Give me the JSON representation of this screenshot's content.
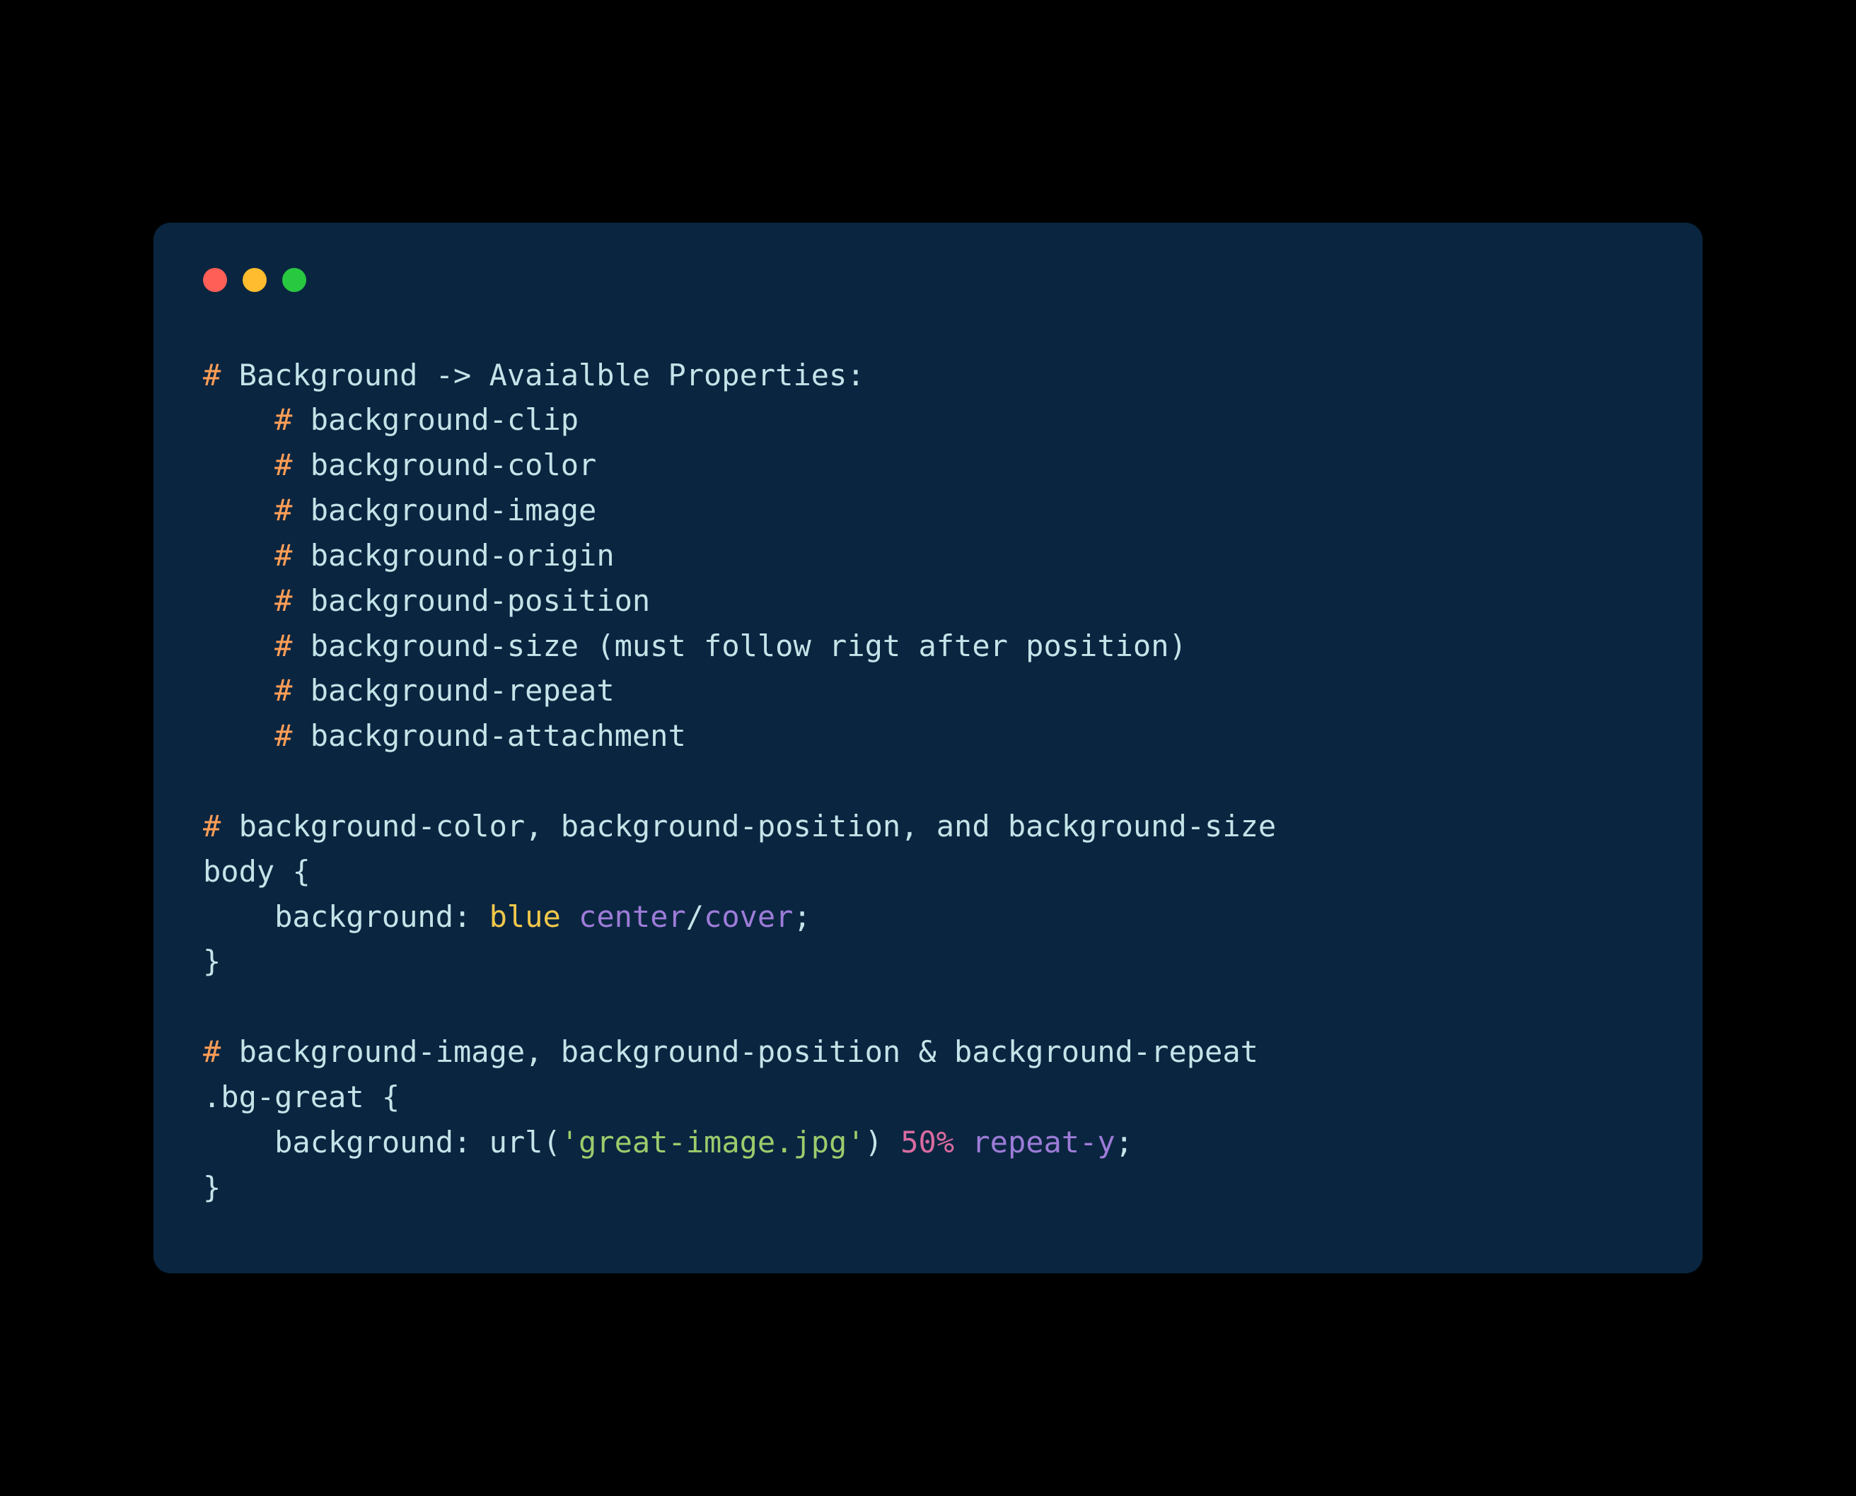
{
  "code": {
    "line1_hash": "#",
    "line1_text": " Background -> Avaialble Properties:",
    "indent": "    ",
    "props": [
      {
        "hash": "#",
        "text": " background-clip"
      },
      {
        "hash": "#",
        "text": " background-color"
      },
      {
        "hash": "#",
        "text": " background-image"
      },
      {
        "hash": "#",
        "text": " background-origin"
      },
      {
        "hash": "#",
        "text": " background-position"
      },
      {
        "hash": "#",
        "text": " background-size (must follow rigt after position)"
      },
      {
        "hash": "#",
        "text": " background-repeat"
      },
      {
        "hash": "#",
        "text": " background-attachment"
      }
    ],
    "comment2_hash": "#",
    "comment2_text": " background-color, background-position, and background-size",
    "rule1_selector": "body ",
    "rule1_open": "{",
    "rule1_prop": "    background",
    "rule1_colon": ": ",
    "rule1_val_blue": "blue",
    "rule1_sp1": " ",
    "rule1_val_center": "center",
    "rule1_slash": "/",
    "rule1_val_cover": "cover",
    "rule1_semi": ";",
    "rule1_close": "}",
    "comment3_hash": "#",
    "comment3_text": " background-image, background-position & background-repeat",
    "rule2_selector": ".bg-great ",
    "rule2_open": "{",
    "rule2_prop": "    background",
    "rule2_colon": ": ",
    "rule2_func": "url",
    "rule2_popen": "(",
    "rule2_string": "'great-image.jpg'",
    "rule2_pclose": ")",
    "rule2_sp1": " ",
    "rule2_num": "50%",
    "rule2_sp2": " ",
    "rule2_repeat": "repeat-y",
    "rule2_semi": ";",
    "rule2_close": "}"
  }
}
